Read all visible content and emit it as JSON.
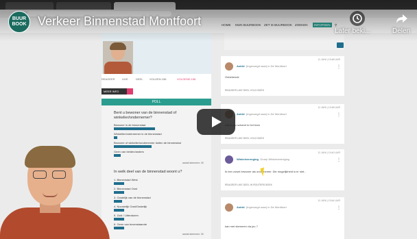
{
  "overlay": {
    "logo_line1": "BUUR",
    "logo_line2": "BOOK",
    "video_title": "Verkeer Binnenstad Montfoort",
    "watch_later_label": "Later beki...",
    "share_label": "Delen"
  },
  "site_nav": {
    "items": [
      "HOME",
      "MIJN BUURBOOK",
      "ZET IS BUURBOOK",
      "ZOEKEN",
      "INFOPOEN"
    ],
    "active_index": 4
  },
  "left_column": {
    "actions": [
      "REAGEER",
      "LIKE",
      "DEEL",
      "VOLGEN 156",
      "VOLGEND 156"
    ],
    "more_info_label": "MEER INFO",
    "poll_header": "POLL",
    "poll1": {
      "question": "Bent u bewoner van de binnenstad of winkelier/ondernemer?",
      "options": [
        {
          "label": "Bewoner in de binnenstad",
          "pct": 0.6
        },
        {
          "label": "Winkelier/ondernemer in de binnenstad",
          "pct": 0.05
        },
        {
          "label": "Bewoner of winkelier/ondernemer buiten de binnenstad",
          "pct": 0.55
        },
        {
          "label": "Geen van beiden/anders",
          "pct": 0.1
        }
      ],
      "votes": "aantal stemmen: 30"
    },
    "poll2": {
      "question": "In welk deel van de binnenstad woont u?",
      "options": [
        {
          "label": "1. Binnenstad West",
          "pct": 0.15
        },
        {
          "label": "2. Binnenstad Oost",
          "pct": 0.15
        },
        {
          "label": "3. Oostelijk van de binnenstad",
          "pct": 0.12
        },
        {
          "label": "4. Noordelijk Oost/Oostelijk",
          "pct": 0.15
        },
        {
          "label": "5. Zuid / Litteraturen",
          "pct": 0.15
        },
        {
          "label": "6. Geen van bovenstaande",
          "pct": 0.15
        }
      ],
      "votes": "aantal stemmen: 30"
    }
  },
  "posts": [
    {
      "meta": "11 JUNI | 13:48 UUR",
      "name": "Astrid",
      "sub": "(Ingevoegd naar) in De Montfoort",
      "body": "Onbekende",
      "actions": "REAGEER   LIKE   DEEL   VOLG BOEK"
    },
    {
      "meta": "11 JUNI | 13:48 UUR",
      "name": "Astrid",
      "sub": "(Ingevoegd naar) in De Montfoort",
      "body": "wat je jou schamt in het tram",
      "actions": "REAGEER   LIKE   DEEL   VOLG BOEK"
    },
    {
      "meta": "11 JUNI | 13:40 UUR",
      "name": "Winkelverenging",
      "sub": "Groep Winkelvereniging",
      "body": "Ik ben zowel bewoner als ondernemer. Die mogelijkheid is er niet...",
      "actions": "REAGEER   LIKE   DEEL   IN ROUTERS BOEK"
    },
    {
      "meta": "11 JUNI | 13:44 UUR",
      "name": "Astrid",
      "sub": "(Ingevoegd naar) in De Montfoort",
      "body": "kan met stemmen via jou ?",
      "actions": ""
    }
  ]
}
